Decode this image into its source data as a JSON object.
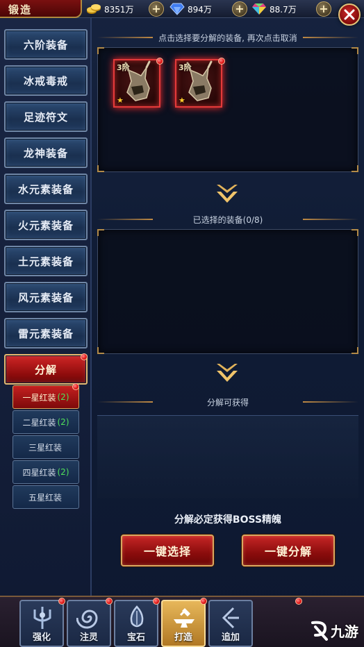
{
  "header": {
    "title": "锻造",
    "currencies": [
      {
        "name": "gold",
        "value": "8351万"
      },
      {
        "name": "diamond",
        "value": "894万"
      },
      {
        "name": "gem",
        "value": "88.7万"
      }
    ],
    "plus_label": "+"
  },
  "sidebar": {
    "items": [
      {
        "label": "六阶装备"
      },
      {
        "label": "冰戒毒戒"
      },
      {
        "label": "足迹符文"
      },
      {
        "label": "龙神装备"
      },
      {
        "label": "水元素装备"
      },
      {
        "label": "火元素装备"
      },
      {
        "label": "土元素装备"
      },
      {
        "label": "风元素装备"
      },
      {
        "label": "雷元素装备"
      },
      {
        "label": "分解"
      }
    ],
    "subitems": [
      {
        "label": "一星红装",
        "count": "(2)"
      },
      {
        "label": "二星红装",
        "count": "(2)"
      },
      {
        "label": "三星红装",
        "count": ""
      },
      {
        "label": "四星红装",
        "count": "(2)"
      },
      {
        "label": "五星红装",
        "count": ""
      }
    ]
  },
  "main": {
    "instruction": "点击选择要分解的装备, 再次点击取消",
    "items": [
      {
        "tier": "3阶",
        "star": "★"
      },
      {
        "tier": "3阶",
        "star": "★"
      }
    ],
    "selected_title": "已选择的装备(0/8)",
    "obtain_title": "分解可获得",
    "notice": "分解必定获得BOSS精魄",
    "btn_select_all": "一键选择",
    "btn_decompose_all": "一键分解"
  },
  "bottom_nav": [
    {
      "label": "强化"
    },
    {
      "label": "注灵"
    },
    {
      "label": "宝石"
    },
    {
      "label": "打造"
    },
    {
      "label": "追加"
    }
  ],
  "watermark": "九游"
}
